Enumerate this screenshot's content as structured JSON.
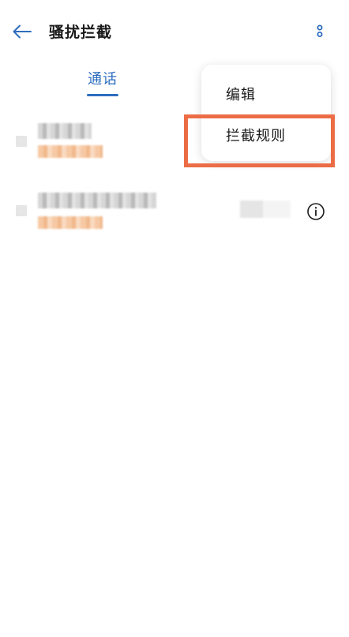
{
  "header": {
    "title": "骚扰拦截",
    "back_icon": "arrow-left-icon",
    "more_icon": "more-vertical-icon",
    "accent_color": "#2e6dbf"
  },
  "tabs": [
    {
      "label": "通话",
      "selected": true
    }
  ],
  "call_list": [
    {
      "name": "",
      "subtitle": "",
      "redacted": true
    },
    {
      "name": "",
      "subtitle": "",
      "time": "",
      "redacted": true,
      "info_icon": "info-icon"
    }
  ],
  "menu": {
    "items": [
      {
        "label": "编辑"
      },
      {
        "label": "拦截规则"
      }
    ],
    "highlighted_item": "拦截规则",
    "highlight_color": "#ec6d45"
  }
}
